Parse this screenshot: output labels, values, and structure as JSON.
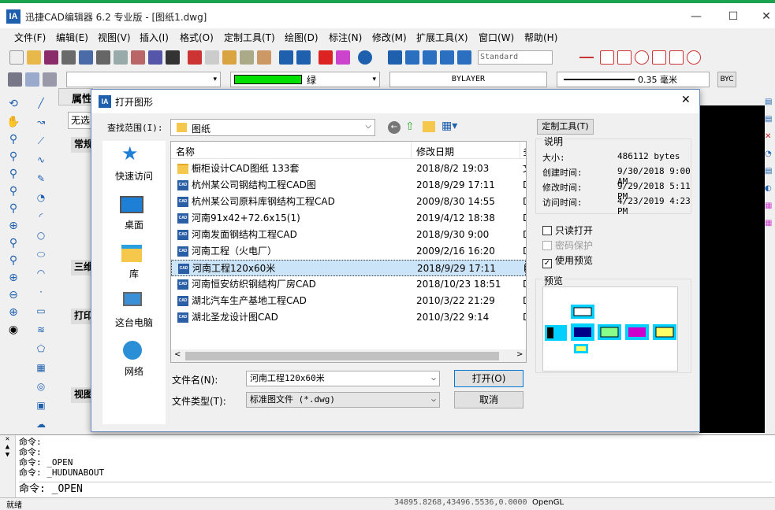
{
  "window": {
    "title": "迅捷CAD编辑器 6.2 专业版 - [图纸1.dwg]",
    "logo": "IA",
    "min": "—",
    "max": "☐",
    "close": "✕"
  },
  "menu": [
    "文件(F)",
    "编辑(E)",
    "视图(V)",
    "插入(I)",
    "格式(O)",
    "定制工具(T)",
    "绘图(D)",
    "标注(N)",
    "修改(M)",
    "扩展工具(X)",
    "窗口(W)",
    "帮助(H)"
  ],
  "toolbar2": {
    "style": "Standard",
    "color_label": "绿",
    "linetype": "BYLAYER",
    "lineweight": "0.35 毫米",
    "byc": "BYC"
  },
  "left_panel": {
    "title": "属性",
    "select": "无选",
    "groups": [
      "常规",
      "三维",
      "打印",
      "视图"
    ],
    "colors": {
      "group_bg": "#e5e5e5"
    }
  },
  "dialog": {
    "title": "打开图形",
    "lookin_label": "查找范围(I):",
    "lookin_value": "图纸",
    "places": [
      "快速访问",
      "桌面",
      "库",
      "这台电脑",
      "网络"
    ],
    "columns": {
      "name": "名称",
      "date": "修改日期",
      "type": "多"
    },
    "files": [
      {
        "name": "橱柜设计CAD图纸 133套",
        "date": "2018/8/2 19:03",
        "kind": "folder",
        "t": "文"
      },
      {
        "name": "杭州某公司钢结构工程CAD图",
        "date": "2018/9/29 17:11",
        "kind": "cad",
        "t": "D"
      },
      {
        "name": "杭州某公司原料库钢结构工程CAD",
        "date": "2009/8/30 14:55",
        "kind": "cad",
        "t": "D"
      },
      {
        "name": "河南91x42+72.6x15(1)",
        "date": "2019/4/12 18:38",
        "kind": "cad",
        "t": "D"
      },
      {
        "name": "河南发面钢结构工程CAD",
        "date": "2018/9/30 9:00",
        "kind": "cad",
        "t": "D"
      },
      {
        "name": "河南工程（火电厂）",
        "date": "2009/2/16 16:20",
        "kind": "cad",
        "t": "D"
      },
      {
        "name": "河南工程120x60米",
        "date": "2018/9/29 17:11",
        "kind": "cad",
        "t": "D",
        "selected": true
      },
      {
        "name": "河南恒安纺织钢结构厂房CAD",
        "date": "2018/10/23 18:51",
        "kind": "cad",
        "t": "D"
      },
      {
        "name": "湖北汽车生产基地工程CAD",
        "date": "2010/3/22 21:29",
        "kind": "cad",
        "t": "D"
      },
      {
        "name": "湖北圣龙设计图CAD",
        "date": "2010/3/22 9:14",
        "kind": "cad",
        "t": "D"
      }
    ],
    "filename_label": "文件名(N):",
    "filename_value": "河南工程120x60米",
    "filetype_label": "文件类型(T):",
    "filetype_value": "标准图文件 (*.dwg)",
    "open_btn": "打开(O)",
    "cancel_btn": "取消",
    "custom_btn": "定制工具(T)",
    "desc_label": "说明",
    "info": [
      {
        "k": "大小:",
        "v": "486112 bytes"
      },
      {
        "k": "创建时间:",
        "v": "9/30/2018 9:00 AM"
      },
      {
        "k": "修改时间:",
        "v": "9/29/2018 5:11 PM"
      },
      {
        "k": "访问时间:",
        "v": "4/23/2019 4:23 PM"
      }
    ],
    "readonly": "只读打开",
    "password": "密码保护",
    "use_preview": "使用预览",
    "preview_label": "预览"
  },
  "command": {
    "lines": [
      "命令:",
      "命令:",
      "命令:  _OPEN",
      "命令:  _HUDUNABOUT"
    ],
    "prompt": "命令:  _OPEN"
  },
  "status": {
    "left": "就绪",
    "coords": "34895.8268,43496.5536,0.0000",
    "right": "OpenGL"
  }
}
